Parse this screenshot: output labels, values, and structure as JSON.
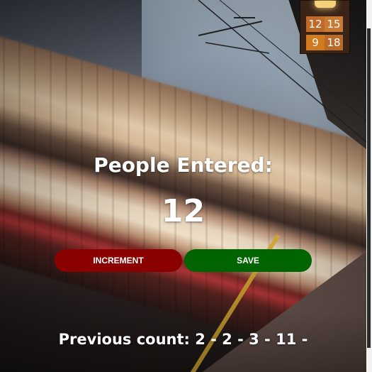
{
  "board": {
    "cells": [
      "12",
      "15",
      "9",
      "18"
    ]
  },
  "counter": {
    "title": "People Entered:",
    "value": "12"
  },
  "actions": {
    "increment_label": "INCREMENT",
    "save_label": "SAVE"
  },
  "history": {
    "text": "Previous count: 2 - 2 - 3 - 11 -"
  },
  "colors": {
    "increment": "#8b0000",
    "save": "#006400",
    "text": "#ffffff"
  }
}
